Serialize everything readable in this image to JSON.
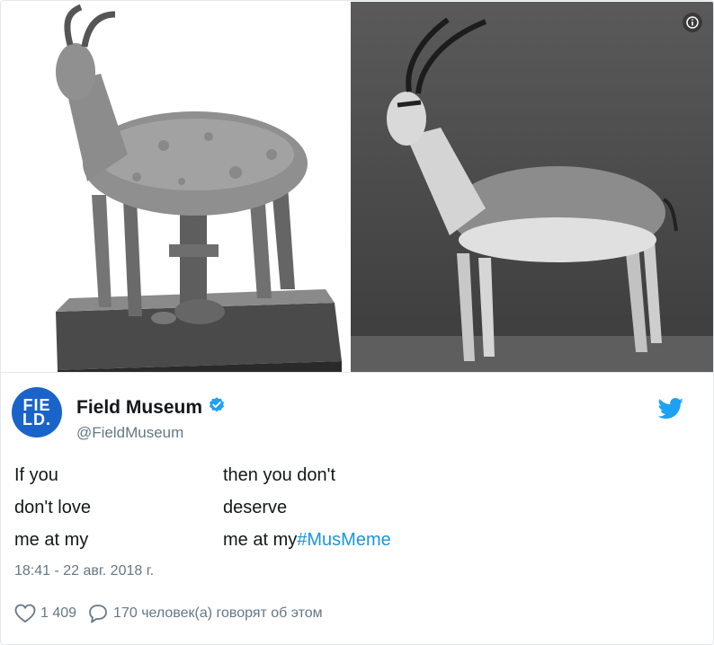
{
  "tweet": {
    "author": {
      "display_name": "Field Museum",
      "handle": "@FieldMuseum",
      "avatar_text_top": "FIE",
      "avatar_text_bottom": "LD.",
      "verified": true
    },
    "lines": [
      {
        "left": "If you",
        "right": "then you don't"
      },
      {
        "left": "don't love",
        "right": "deserve"
      },
      {
        "left": "me at my",
        "right": "me at my",
        "hashtag": "#MusMeme"
      }
    ],
    "timestamp": "18:41 - 22 авг. 2018 г.",
    "likes": "1 409",
    "replies_text": "170 человек(а) говорят об этом"
  },
  "icons": {
    "info": "info-icon",
    "bird": "twitter-bird-icon",
    "verified": "verified-badge-icon",
    "like": "heart-icon",
    "reply": "reply-bubble-icon"
  },
  "colors": {
    "link": "#1b95e0",
    "avatar": "#1a63c9",
    "verified": "#1da1f2",
    "muted": "#657786",
    "text": "#14171a"
  }
}
